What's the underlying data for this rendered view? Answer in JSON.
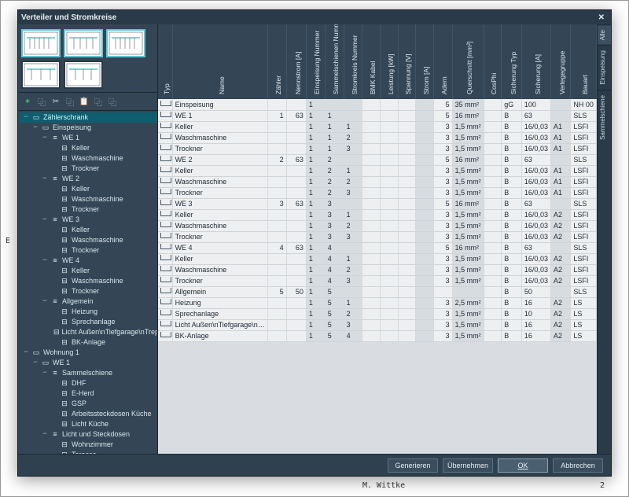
{
  "backdrop": {
    "author": "M. Wittke",
    "page": "2",
    "side_letter": "E"
  },
  "dialog": {
    "title": "Verteiler und Stromkreise",
    "close": "✕"
  },
  "toolbar": {
    "add": "+",
    "copy_sheet": "⿻",
    "cut": "✂",
    "copy": "⿻",
    "paste": "📋",
    "dup1": "⿻",
    "dup2": "⿻"
  },
  "tree": [
    {
      "d": 0,
      "t": "−",
      "i": "▭",
      "l": "Zählerschrank",
      "sel": true
    },
    {
      "d": 1,
      "t": "−",
      "i": "▭",
      "l": "Einspeisung"
    },
    {
      "d": 2,
      "t": "−",
      "i": "≡",
      "l": "WE 1"
    },
    {
      "d": 3,
      "t": "",
      "i": "⊟",
      "l": "Keller"
    },
    {
      "d": 3,
      "t": "",
      "i": "⊟",
      "l": "Waschmaschine"
    },
    {
      "d": 3,
      "t": "",
      "i": "⊟",
      "l": "Trockner"
    },
    {
      "d": 2,
      "t": "−",
      "i": "≡",
      "l": "WE 2"
    },
    {
      "d": 3,
      "t": "",
      "i": "⊟",
      "l": "Keller"
    },
    {
      "d": 3,
      "t": "",
      "i": "⊟",
      "l": "Waschmaschine"
    },
    {
      "d": 3,
      "t": "",
      "i": "⊟",
      "l": "Trockner"
    },
    {
      "d": 2,
      "t": "−",
      "i": "≡",
      "l": "WE 3"
    },
    {
      "d": 3,
      "t": "",
      "i": "⊟",
      "l": "Keller"
    },
    {
      "d": 3,
      "t": "",
      "i": "⊟",
      "l": "Waschmaschine"
    },
    {
      "d": 3,
      "t": "",
      "i": "⊟",
      "l": "Trockner"
    },
    {
      "d": 2,
      "t": "−",
      "i": "≡",
      "l": "WE 4"
    },
    {
      "d": 3,
      "t": "",
      "i": "⊟",
      "l": "Keller"
    },
    {
      "d": 3,
      "t": "",
      "i": "⊟",
      "l": "Waschmaschine"
    },
    {
      "d": 3,
      "t": "",
      "i": "⊟",
      "l": "Trockner"
    },
    {
      "d": 2,
      "t": "−",
      "i": "≡",
      "l": "Allgemein"
    },
    {
      "d": 3,
      "t": "",
      "i": "⊟",
      "l": "Heizung"
    },
    {
      "d": 3,
      "t": "",
      "i": "⊟",
      "l": "Sprechanlage"
    },
    {
      "d": 3,
      "t": "",
      "i": "⊟",
      "l": "Licht Außen\\nTiefgarage\\nTreppenh..."
    },
    {
      "d": 3,
      "t": "",
      "i": "⊟",
      "l": "BK-Anlage"
    },
    {
      "d": 0,
      "t": "−",
      "i": "▭",
      "l": "Wohnung 1"
    },
    {
      "d": 1,
      "t": "−",
      "i": "▭",
      "l": "WE 1"
    },
    {
      "d": 2,
      "t": "−",
      "i": "≡",
      "l": "Sammelschiene"
    },
    {
      "d": 3,
      "t": "",
      "i": "⊟",
      "l": "DHF"
    },
    {
      "d": 3,
      "t": "",
      "i": "⊟",
      "l": "E-Herd"
    },
    {
      "d": 3,
      "t": "",
      "i": "⊟",
      "l": "GSP"
    },
    {
      "d": 3,
      "t": "",
      "i": "⊟",
      "l": "Arbeitssteckdosen Küche"
    },
    {
      "d": 3,
      "t": "",
      "i": "⊟",
      "l": "Licht Küche"
    },
    {
      "d": 2,
      "t": "−",
      "i": "≡",
      "l": "Licht und Steckdosen"
    },
    {
      "d": 3,
      "t": "",
      "i": "⊟",
      "l": "Wohnzimmer"
    },
    {
      "d": 3,
      "t": "",
      "i": "⊟",
      "l": "Terasse"
    }
  ],
  "columns": [
    {
      "key": "typ",
      "label": "Typ",
      "w": "typ"
    },
    {
      "key": "name",
      "label": "Name",
      "w": "wide"
    },
    {
      "key": "zaehler",
      "label": "Zähler"
    },
    {
      "key": "nennstrom",
      "label": "Nennstrom [A]"
    },
    {
      "key": "einsp",
      "label": "Einspeisung Nummer"
    },
    {
      "key": "sammel",
      "label": "Sammelschienen Nummer"
    },
    {
      "key": "stromkreis",
      "label": "Stromkreis Nummer"
    },
    {
      "key": "bmk",
      "label": "BMK Kabel"
    },
    {
      "key": "leistung",
      "label": "Leistung [kW]"
    },
    {
      "key": "spannung",
      "label": "Spannung [V]"
    },
    {
      "key": "strom",
      "label": "Strom [A]"
    },
    {
      "key": "adern",
      "label": "Adern"
    },
    {
      "key": "querschnitt",
      "label": "Querschnitt [mm²]"
    },
    {
      "key": "cosphi",
      "label": "CosPhi"
    },
    {
      "key": "sichtyp",
      "label": "Sicherung Typ"
    },
    {
      "key": "sicha",
      "label": "Sicherung [A]"
    },
    {
      "key": "verlege",
      "label": "Verlegegruppe"
    },
    {
      "key": "bauart",
      "label": "Bauart"
    }
  ],
  "rows": [
    {
      "name": "Einspeisung",
      "zaehler": "",
      "nennstrom": "",
      "einsp": "1",
      "sammel": "",
      "stromkreis": "",
      "adern": "5",
      "querschnitt": "35 mm²",
      "sichtyp": "gG",
      "sicha": "100",
      "verlege": "",
      "bauart": "NH 00"
    },
    {
      "name": "WE 1",
      "zaehler": "1",
      "nennstrom": "63",
      "einsp": "1",
      "sammel": "1",
      "stromkreis": "",
      "adern": "5",
      "querschnitt": "16 mm²",
      "sichtyp": "B",
      "sicha": "63",
      "verlege": "",
      "bauart": "SLS"
    },
    {
      "name": "Keller",
      "einsp": "1",
      "sammel": "1",
      "stromkreis": "1",
      "adern": "3",
      "querschnitt": "1,5 mm²",
      "sichtyp": "B",
      "sicha": "16/0,03",
      "verlege": "A1",
      "bauart": "LSFI"
    },
    {
      "name": "Waschmaschine",
      "einsp": "1",
      "sammel": "1",
      "stromkreis": "2",
      "adern": "3",
      "querschnitt": "1,5 mm²",
      "sichtyp": "B",
      "sicha": "16/0,03",
      "verlege": "A1",
      "bauart": "LSFI"
    },
    {
      "name": "Trockner",
      "einsp": "1",
      "sammel": "1",
      "stromkreis": "3",
      "adern": "3",
      "querschnitt": "1,5 mm²",
      "sichtyp": "B",
      "sicha": "16/0,03",
      "verlege": "A1",
      "bauart": "LSFI"
    },
    {
      "name": "WE 2",
      "zaehler": "2",
      "nennstrom": "63",
      "einsp": "1",
      "sammel": "2",
      "stromkreis": "",
      "adern": "5",
      "querschnitt": "16 mm²",
      "sichtyp": "B",
      "sicha": "63",
      "verlege": "",
      "bauart": "SLS"
    },
    {
      "name": "Keller",
      "einsp": "1",
      "sammel": "2",
      "stromkreis": "1",
      "adern": "3",
      "querschnitt": "1,5 mm²",
      "sichtyp": "B",
      "sicha": "16/0,03",
      "verlege": "A1",
      "bauart": "LSFI"
    },
    {
      "name": "Waschmaschine",
      "einsp": "1",
      "sammel": "2",
      "stromkreis": "2",
      "adern": "3",
      "querschnitt": "1,5 mm²",
      "sichtyp": "B",
      "sicha": "16/0,03",
      "verlege": "A1",
      "bauart": "LSFI"
    },
    {
      "name": "Trockner",
      "einsp": "1",
      "sammel": "2",
      "stromkreis": "3",
      "adern": "3",
      "querschnitt": "1,5 mm²",
      "sichtyp": "B",
      "sicha": "16/0,03",
      "verlege": "A1",
      "bauart": "LSFI"
    },
    {
      "name": "WE 3",
      "zaehler": "3",
      "nennstrom": "63",
      "einsp": "1",
      "sammel": "3",
      "stromkreis": "",
      "adern": "5",
      "querschnitt": "16 mm²",
      "sichtyp": "B",
      "sicha": "63",
      "verlege": "",
      "bauart": "SLS"
    },
    {
      "name": "Keller",
      "einsp": "1",
      "sammel": "3",
      "stromkreis": "1",
      "adern": "3",
      "querschnitt": "1,5 mm²",
      "sichtyp": "B",
      "sicha": "16/0,03",
      "verlege": "A2",
      "bauart": "LSFI"
    },
    {
      "name": "Waschmaschine",
      "einsp": "1",
      "sammel": "3",
      "stromkreis": "2",
      "adern": "3",
      "querschnitt": "1,5 mm²",
      "sichtyp": "B",
      "sicha": "16/0,03",
      "verlege": "A2",
      "bauart": "LSFI"
    },
    {
      "name": "Trockner",
      "einsp": "1",
      "sammel": "3",
      "stromkreis": "3",
      "adern": "3",
      "querschnitt": "1,5 mm²",
      "sichtyp": "B",
      "sicha": "16/0,03",
      "verlege": "A2",
      "bauart": "LSFI"
    },
    {
      "name": "WE 4",
      "zaehler": "4",
      "nennstrom": "63",
      "einsp": "1",
      "sammel": "4",
      "stromkreis": "",
      "adern": "5",
      "querschnitt": "16 mm²",
      "sichtyp": "B",
      "sicha": "63",
      "verlege": "",
      "bauart": "SLS"
    },
    {
      "name": "Keller",
      "einsp": "1",
      "sammel": "4",
      "stromkreis": "1",
      "adern": "3",
      "querschnitt": "1,5 mm²",
      "sichtyp": "B",
      "sicha": "16/0,03",
      "verlege": "A2",
      "bauart": "LSFI"
    },
    {
      "name": "Waschmaschine",
      "einsp": "1",
      "sammel": "4",
      "stromkreis": "2",
      "adern": "3",
      "querschnitt": "1,5 mm²",
      "sichtyp": "B",
      "sicha": "16/0,03",
      "verlege": "A2",
      "bauart": "LSFI"
    },
    {
      "name": "Trockner",
      "einsp": "1",
      "sammel": "4",
      "stromkreis": "3",
      "adern": "3",
      "querschnitt": "1,5 mm²",
      "sichtyp": "B",
      "sicha": "16/0,03",
      "verlege": "A2",
      "bauart": "LSFI"
    },
    {
      "name": "Allgemein",
      "zaehler": "5",
      "nennstrom": "50",
      "einsp": "1",
      "sammel": "5",
      "stromkreis": "",
      "adern": "",
      "querschnitt": "",
      "sichtyp": "B",
      "sicha": "50",
      "verlege": "",
      "bauart": "SLS"
    },
    {
      "name": "Heizung",
      "einsp": "1",
      "sammel": "5",
      "stromkreis": "1",
      "adern": "3",
      "querschnitt": "2,5 mm²",
      "sichtyp": "B",
      "sicha": "16",
      "verlege": "A2",
      "bauart": "LS"
    },
    {
      "name": "Sprechanlage",
      "einsp": "1",
      "sammel": "5",
      "stromkreis": "2",
      "adern": "3",
      "querschnitt": "1,5 mm²",
      "sichtyp": "B",
      "sicha": "10",
      "verlege": "A2",
      "bauart": "LS"
    },
    {
      "name": "Licht Außen\\nTiefgarage\\n…",
      "einsp": "1",
      "sammel": "5",
      "stromkreis": "3",
      "adern": "3",
      "querschnitt": "1,5 mm²",
      "sichtyp": "B",
      "sicha": "16",
      "verlege": "A2",
      "bauart": "LS"
    },
    {
      "name": "BK-Anlage",
      "einsp": "1",
      "sammel": "5",
      "stromkreis": "4",
      "adern": "3",
      "querschnitt": "1,5 mm²",
      "sichtyp": "B",
      "sicha": "16",
      "verlege": "A2",
      "bauart": "LS"
    }
  ],
  "side_tabs": [
    "Alle",
    "Einspeisung",
    "Sammelschiene"
  ],
  "footer": {
    "generate": "Generieren",
    "apply": "Übernehmen",
    "ok": "OK",
    "cancel": "Abbrechen"
  }
}
